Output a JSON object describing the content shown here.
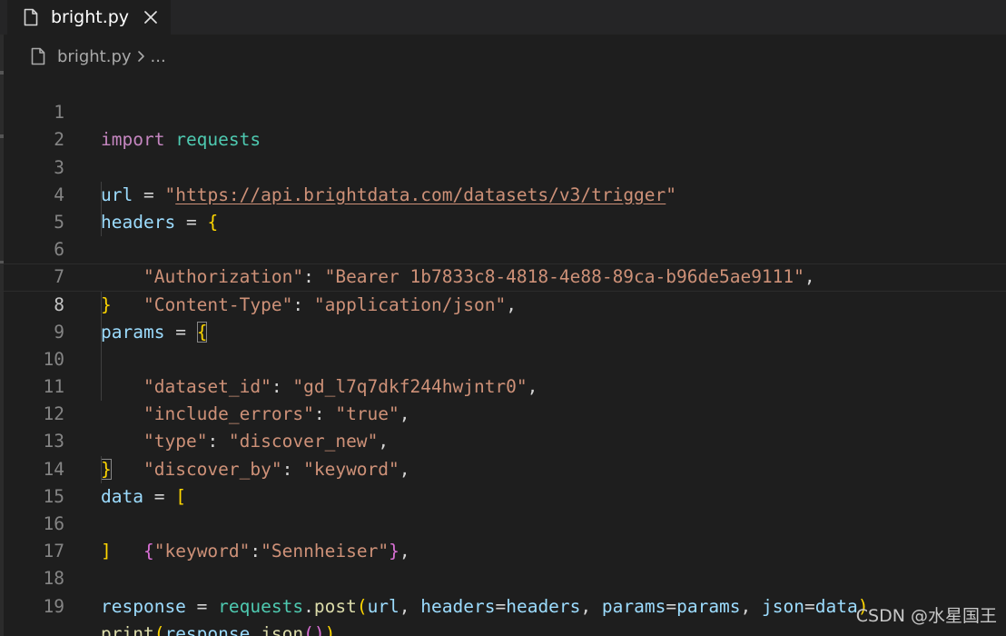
{
  "tabs": [
    {
      "label": "bright.py",
      "icon": "file-icon",
      "active": true
    }
  ],
  "breadcrumb": {
    "file": "bright.py",
    "separator_icon": "chevron-right-icon",
    "ellipsis": "..."
  },
  "editor": {
    "current_line": 8,
    "lines": [
      {
        "n": "1"
      },
      {
        "n": "2"
      },
      {
        "n": "3"
      },
      {
        "n": "4"
      },
      {
        "n": "5"
      },
      {
        "n": "6"
      },
      {
        "n": "7"
      },
      {
        "n": "8"
      },
      {
        "n": "9"
      },
      {
        "n": "10"
      },
      {
        "n": "11"
      },
      {
        "n": "12"
      },
      {
        "n": "13"
      },
      {
        "n": "14"
      },
      {
        "n": "15"
      },
      {
        "n": "16"
      },
      {
        "n": "17"
      },
      {
        "n": "18"
      },
      {
        "n": "19"
      }
    ],
    "code": {
      "import": "import",
      "requests": "requests",
      "url": "url",
      "url_value": "https://api.brightdata.com/datasets/v3/trigger",
      "headers": "headers",
      "auth_key": "Authorization",
      "auth_value": "Bearer 1b7833c8-4818-4e88-89ca-b96de5ae9111",
      "ctype_key": "Content-Type",
      "ctype_value": "application/json",
      "params": "params",
      "dataset_id_key": "dataset_id",
      "dataset_id_value": "gd_l7q7dkf244hwjntr0",
      "include_errors_key": "include_errors",
      "include_errors_value": "true",
      "type_key": "type",
      "type_value": "discover_new",
      "discover_by_key": "discover_by",
      "discover_by_value": "keyword",
      "data": "data",
      "keyword_key": "keyword",
      "keyword_value": "Sennheiser",
      "response": "response",
      "post": "post",
      "json_kw": "json",
      "print": "print",
      "json_fn": "json"
    }
  },
  "colors": {
    "background": "#1e1e1e",
    "keyword": "#c586c0",
    "module": "#4ec9b0",
    "variable": "#9cdcfe",
    "function": "#dcdcaa",
    "string": "#ce9178",
    "bracket_level1": "#ffd700",
    "bracket_level2": "#da70d6"
  },
  "watermark": "CSDN @水星国王"
}
